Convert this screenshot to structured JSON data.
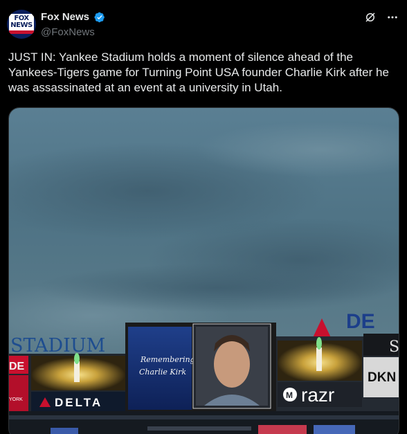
{
  "author": {
    "display_name": "Fox News",
    "handle": "@FoxNews",
    "avatar_text": "FOX NEWS"
  },
  "post": {
    "text": "JUST IN: Yankee Stadium holds a moment of silence ahead of the Yankees-Tigers game for Turning Point USA founder Charlie Kirk after he was assassinated at an event at a university in Utah."
  },
  "media": {
    "stadium_sign": "STADIUM",
    "left_banner_fragment": "DE",
    "york_fragment": "YORK",
    "delta_left": "DELTA",
    "tribute_line1": "Remembering",
    "tribute_line2": "Charlie Kirk",
    "delta_right": "DE",
    "razr": "razr",
    "dkny": "DKN",
    "right_s": "S"
  },
  "icons": {
    "grok": "grok-icon",
    "more": "more-icon",
    "verified": "verified-badge-icon"
  },
  "colors": {
    "background": "#000000",
    "text_primary": "#e7e9ea",
    "text_secondary": "#71767b",
    "verified_blue": "#1d9bf0"
  }
}
